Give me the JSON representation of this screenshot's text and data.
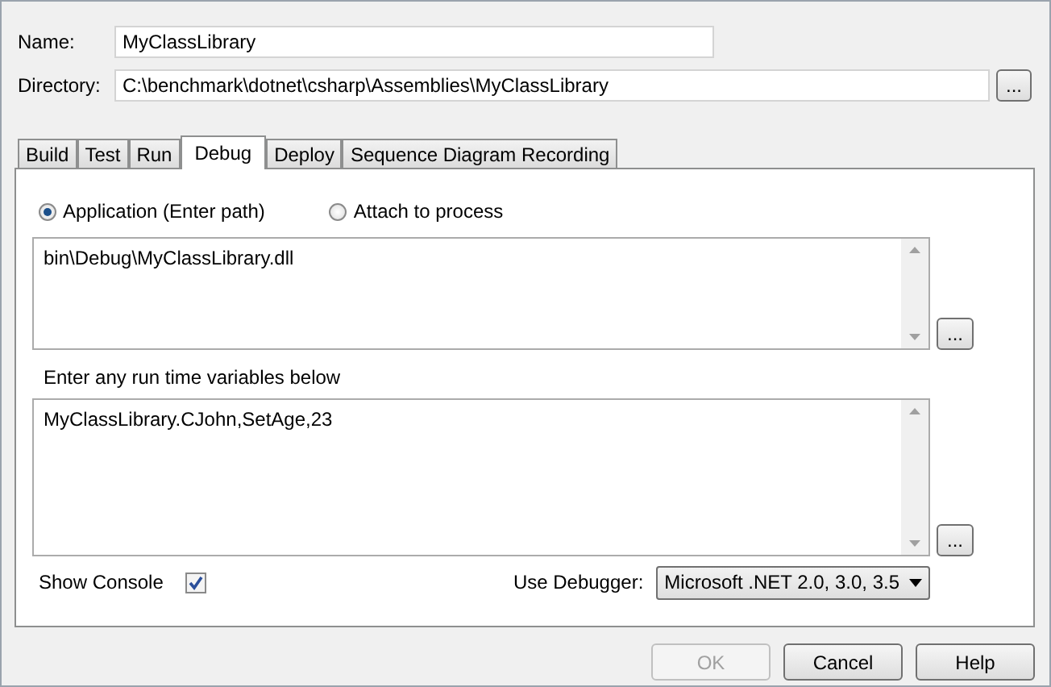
{
  "name_field": {
    "label": "Name:",
    "value": "MyClassLibrary"
  },
  "directory_field": {
    "label": "Directory:",
    "value": "C:\\benchmark\\dotnet\\csharp\\Assemblies\\MyClassLibrary",
    "browse_button": "..."
  },
  "tabs": [
    {
      "label": "Build",
      "selected": false
    },
    {
      "label": "Test",
      "selected": false
    },
    {
      "label": "Run",
      "selected": false
    },
    {
      "label": "Debug",
      "selected": true
    },
    {
      "label": "Deploy",
      "selected": false
    },
    {
      "label": "Sequence Diagram Recording",
      "selected": false
    }
  ],
  "debug_panel": {
    "mode_options": [
      {
        "label": "Application (Enter path)",
        "selected": true
      },
      {
        "label": "Attach to process",
        "selected": false
      }
    ],
    "path_box": {
      "value": "bin\\Debug\\MyClassLibrary.dll",
      "browse_button": "..."
    },
    "variables_label": "Enter any run time variables below",
    "variables_box": {
      "value": "MyClassLibrary.CJohn,SetAge,23",
      "browse_button": "..."
    },
    "show_console": {
      "label": "Show Console",
      "checked": true
    },
    "debugger": {
      "label": "Use Debugger:",
      "value": "Microsoft .NET 2.0, 3.0, 3.5"
    }
  },
  "buttons": [
    {
      "label": "OK",
      "disabled": true
    },
    {
      "label": "Cancel",
      "disabled": false
    },
    {
      "label": "Help",
      "disabled": false
    }
  ]
}
